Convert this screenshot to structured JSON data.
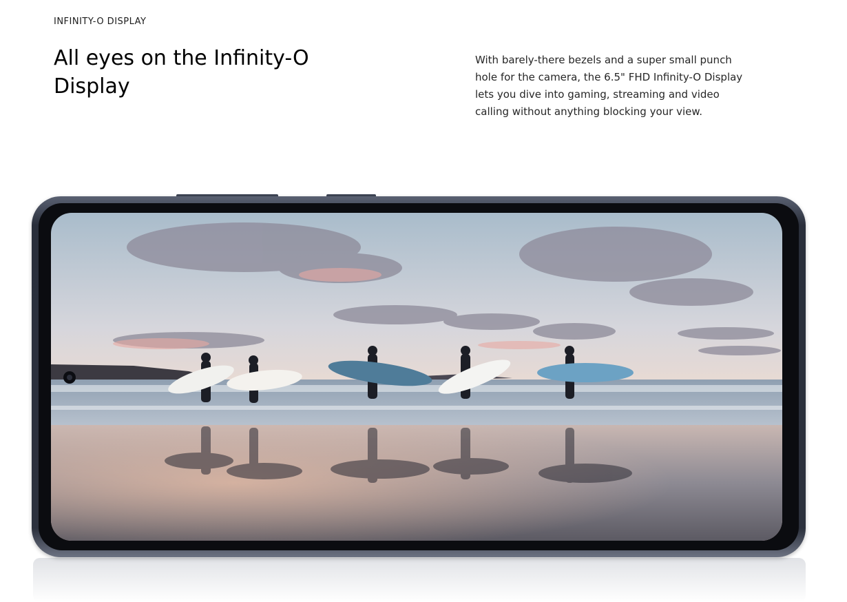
{
  "section": {
    "eyebrow": "INFINITY-O DISPLAY",
    "headline": "All eyes on the Infinity-O Display",
    "description": "With barely-there bezels and a super small punch hole for the camera, the 6.5\" FHD Infinity-O Display lets you dive into gaming, streaming and video calling without anything blocking your view."
  },
  "phone": {
    "image_subject": "surfers-walking-on-beach-at-sunset",
    "frame_color": "#2c313d",
    "punch_hole": "camera-icon"
  }
}
